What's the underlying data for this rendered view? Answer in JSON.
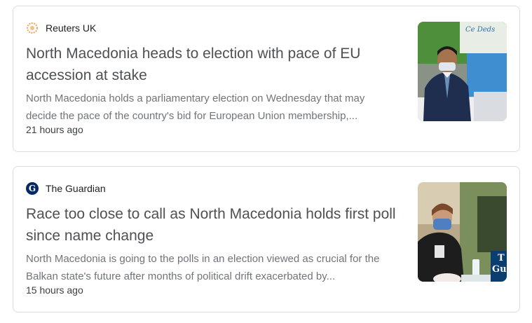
{
  "results": [
    {
      "source": "Reuters UK",
      "logo_icon": "reuters-logo-icon",
      "title_line1": "North Macedonia heads to election with pace of EU",
      "title_line2": "accession at stake",
      "snippet_line1": "North Macedonia holds a parliamentary election on Wednesday that may",
      "snippet_line2": "decide the pace of the country's bid for European Union membership,...",
      "time": "21 hours ago",
      "image_text": "Ce Deds"
    },
    {
      "source": "The Guardian",
      "logo_icon": "guardian-logo-icon",
      "logo_letter": "G",
      "title_line1": "Race too close to call as North Macedonia holds first poll",
      "title_line2": "since name change",
      "snippet_line1": "North Macedonia is going to the polls in an election viewed as crucial for the",
      "snippet_line2": "Balkan state's future after months of political drift exacerbated by...",
      "time": "15 hours ago",
      "image_text_line1": "T",
      "image_text_line2": "Gu"
    }
  ]
}
